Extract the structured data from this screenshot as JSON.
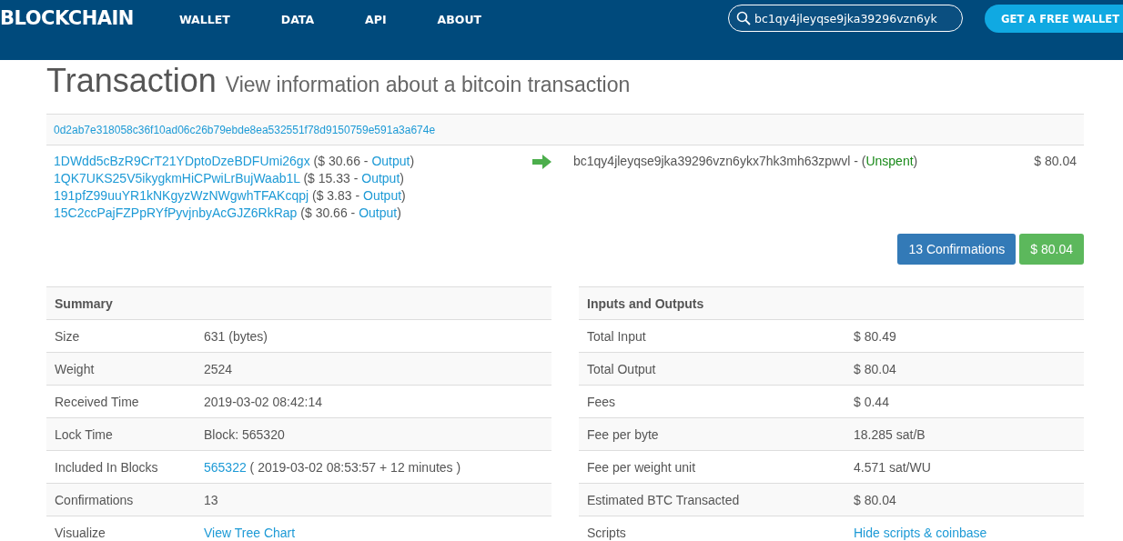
{
  "header": {
    "logo": "BLOCKCHAIN",
    "nav": [
      {
        "label": "WALLET"
      },
      {
        "label": "DATA"
      },
      {
        "label": "API"
      },
      {
        "label": "ABOUT"
      }
    ],
    "search": {
      "value": "bc1qy4jleyqse9jka39296vzn6yk"
    },
    "cta": "GET A FREE WALLET"
  },
  "title": "Transaction",
  "subtitle": "View information about a bitcoin transaction",
  "tx_hash": "0d2ab7e318058c36f10ad06c26b79ebde8ea532551f78d9150759e591a3a674e",
  "inputs": [
    {
      "address": "1DWdd5cBzR9CrT21YDptoDzeBDFUmi26gx",
      "detail": "($ 30.66 -",
      "link": "Output",
      "end": ")"
    },
    {
      "address": "1QK7UKS25V5ikygkmHiCPwiLrBujWaab1L",
      "detail": "($ 15.33 -",
      "link": "Output",
      "end": ")"
    },
    {
      "address": "191pfZ99uuYR1kNKgyzWzNWgwhTFAKcqpj",
      "detail": "($ 3.83 -",
      "link": "Output",
      "end": ")"
    },
    {
      "address": "15C2ccPajFZPpRYfPyvjnbyAcGJZ6RkRap",
      "detail": "($ 30.66 -",
      "link": "Output",
      "end": ")"
    }
  ],
  "outputs": [
    {
      "address": "bc1qy4jleyqse9jka39296vzn6ykx7hk3mh63zpwvl",
      "detail": "- (",
      "status": "Unspent",
      "end": ")",
      "amount": "$ 80.04"
    }
  ],
  "badges": [
    {
      "kind": "primary",
      "label": "13 Confirmations"
    },
    {
      "kind": "success",
      "label": "$ 80.04"
    }
  ],
  "tables": [
    {
      "title": "Summary",
      "rows": [
        {
          "label": "Size",
          "text": "631 (bytes)"
        },
        {
          "label": "Weight",
          "text": "2524"
        },
        {
          "label": "Received Time",
          "text": "2019-03-02 08:42:14"
        },
        {
          "label": "Lock Time",
          "text": "Block: 565320"
        },
        {
          "label": "Included In Blocks",
          "link": "565322",
          "text": "( 2019-03-02 08:53:57 + 12 minutes )"
        },
        {
          "label": "Confirmations",
          "text": "13"
        },
        {
          "label": "Visualize",
          "link": "View Tree Chart"
        }
      ]
    },
    {
      "title": "Inputs and Outputs",
      "rows": [
        {
          "label": "Total Input",
          "text": "$ 80.49"
        },
        {
          "label": "Total Output",
          "text": "$ 80.04"
        },
        {
          "label": "Fees",
          "text": "$ 0.44"
        },
        {
          "label": "Fee per byte",
          "text": "18.285 sat/B"
        },
        {
          "label": "Fee per weight unit",
          "text": "4.571 sat/WU"
        },
        {
          "label": "Estimated BTC Transacted",
          "text": "$ 80.04"
        },
        {
          "label": "Scripts",
          "link": "Hide scripts & coinbase"
        }
      ]
    }
  ]
}
